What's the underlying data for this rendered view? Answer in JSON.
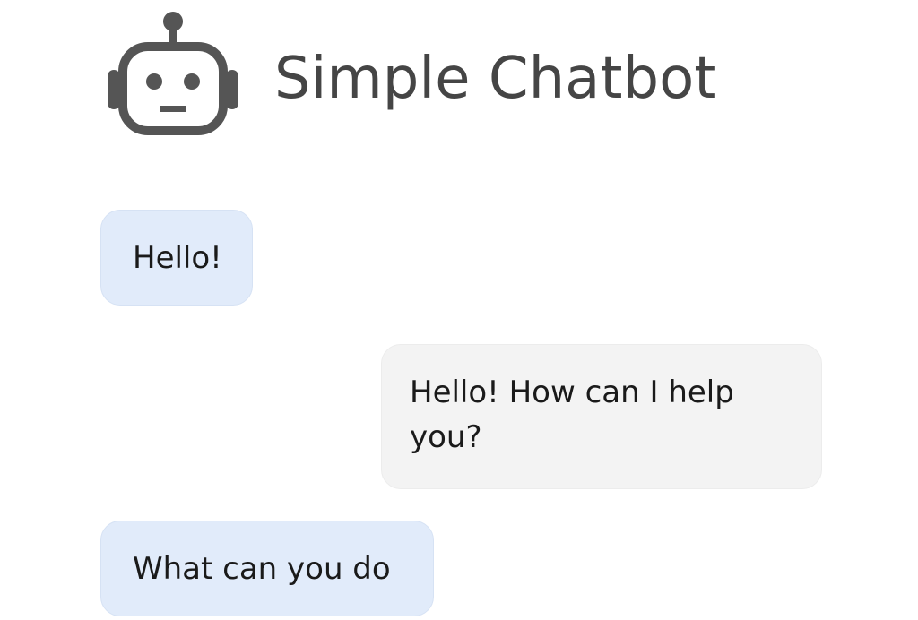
{
  "header": {
    "title": "Simple Chatbot",
    "logo_icon": "robot-icon"
  },
  "colors": {
    "title": "#454545",
    "user_bubble": "#e1ebfa",
    "bot_bubble": "#f3f3f3",
    "text": "#1a1a1a",
    "icon": "#555555"
  },
  "messages": [
    {
      "sender": "user",
      "text": "Hello!"
    },
    {
      "sender": "bot",
      "text": "Hello! How can I help you?"
    },
    {
      "sender": "user",
      "text": "What can you do"
    }
  ]
}
